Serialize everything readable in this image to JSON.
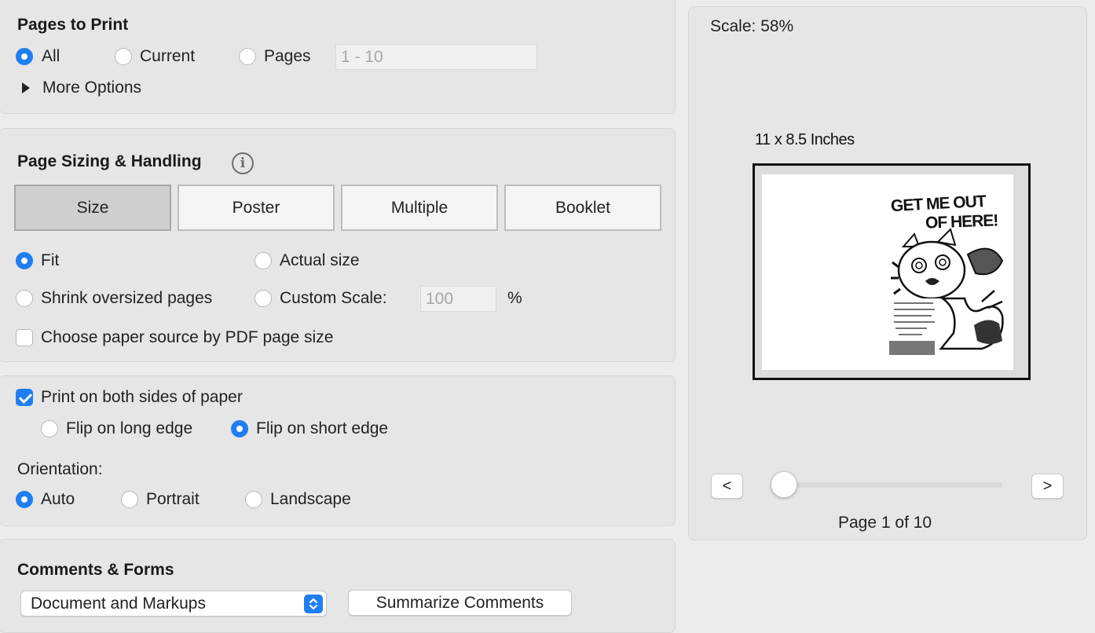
{
  "pages_to_print": {
    "title": "Pages to Print",
    "all_label": "All",
    "current_label": "Current",
    "pages_label": "Pages",
    "pages_placeholder": "1 - 10",
    "more_options": "More Options"
  },
  "page_sizing": {
    "title": "Page Sizing & Handling",
    "tabs": [
      "Size",
      "Poster",
      "Multiple",
      "Booklet"
    ],
    "fit": "Fit",
    "actual_size": "Actual size",
    "shrink": "Shrink oversized pages",
    "custom_scale": "Custom Scale:",
    "custom_scale_value": "100",
    "percent": "%",
    "choose_paper": "Choose paper source by PDF page size"
  },
  "duplex": {
    "print_both_sides": "Print on both sides of paper",
    "flip_long": "Flip on long edge",
    "flip_short": "Flip on short edge",
    "orientation_label": "Orientation:",
    "auto": "Auto",
    "portrait": "Portrait",
    "landscape": "Landscape"
  },
  "comments": {
    "title": "Comments & Forms",
    "select_value": "Document and Markups",
    "summarize": "Summarize Comments"
  },
  "preview": {
    "scale": "Scale:  58%",
    "paper_size": "11 x 8.5 Inches",
    "comic_title_line1": "GET ME OUT",
    "comic_title_line2": "OF HERE!",
    "prev": "<",
    "next": ">",
    "page_indicator": "Page 1 of 10",
    "page_slider_fraction": 0
  },
  "colors": {
    "accent": "#1f7ff0",
    "panel": "#e6e6e6",
    "background": "#ececec"
  }
}
